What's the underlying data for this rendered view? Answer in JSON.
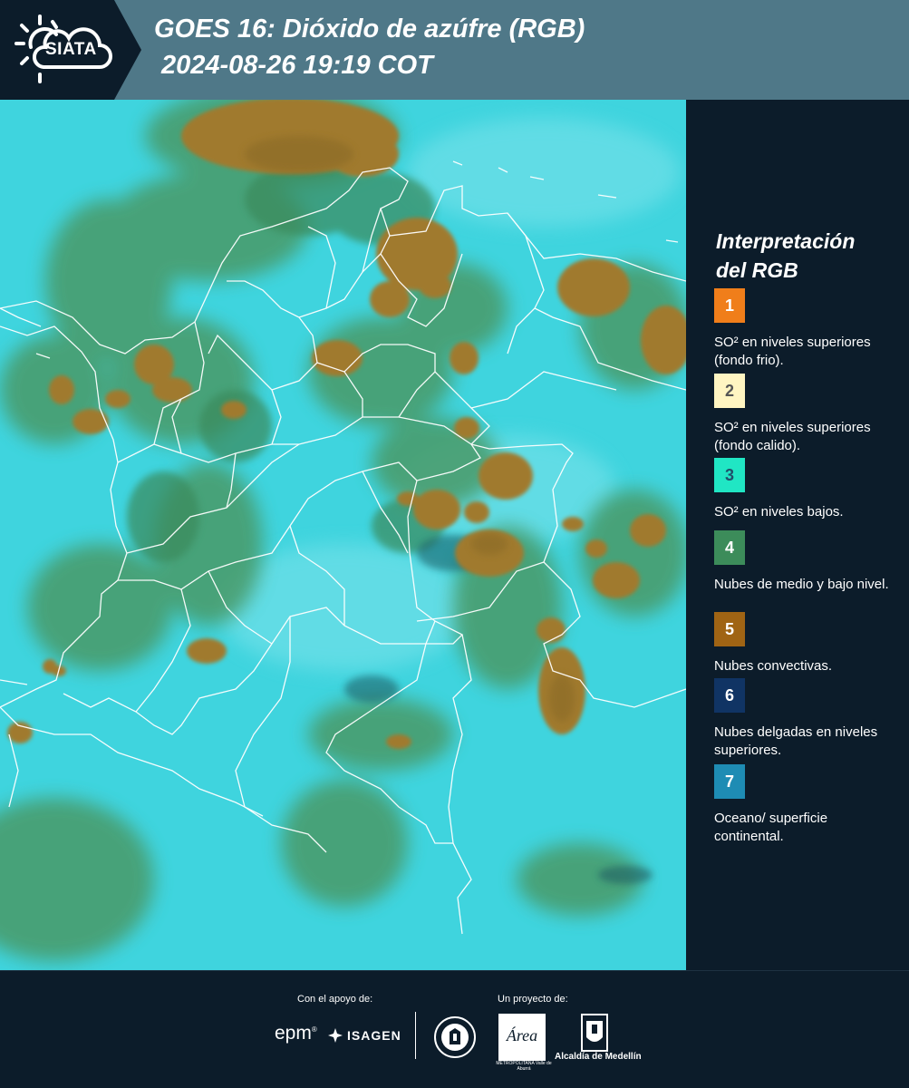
{
  "header": {
    "logo_text": "SIATA",
    "title_line1": "GOES 16: Dióxido de azúfre (RGB)",
    "title_line2": "2024-08-26 19:19 COT"
  },
  "legend": {
    "title_line1": "Interpretación",
    "title_line2": "del RGB",
    "items": [
      {
        "number": "1",
        "text": "SO² en niveles superiores (fondo frio).",
        "color": "#f07e1a",
        "number_color": "#ffffff"
      },
      {
        "number": "2",
        "text": "SO² en niveles superiores (fondo calido).",
        "color": "#fff5c2",
        "number_color": "#555555"
      },
      {
        "number": "3",
        "text": "SO² en niveles bajos.",
        "color": "#20e6c4",
        "number_color": "#20506a"
      },
      {
        "number": "4",
        "text": "Nubes de medio y bajo nivel.",
        "color": "#3c8c5a",
        "number_color": "#ffffff"
      },
      {
        "number": "5",
        "text": "Nubes convectivas.",
        "color": "#a06414",
        "number_color": "#ffffff"
      },
      {
        "number": "6",
        "text": "Nubes delgadas en niveles superiores.",
        "color": "#103464",
        "number_color": "#ffffff"
      },
      {
        "number": "7",
        "text": "Oceano/ superficie continental.",
        "color": "#1e8cb4",
        "number_color": "#ffffff"
      }
    ]
  },
  "footer": {
    "support_label": "Con el apoyo de:",
    "project_label": "Un proyecto de:",
    "epm": "epm",
    "isagen": "ISAGEN",
    "area_name": "Área",
    "area_subtitle": "METROPOLITANA Valle de Aburrá",
    "alcaldia": "Alcaldía de Medellín"
  },
  "colors": {
    "background": "#0c1c2a",
    "header_bar": "#4f7888",
    "map_base": "#3fd4de",
    "cloud_green": "#4a9a68",
    "cloud_brown": "#a07a2e"
  }
}
